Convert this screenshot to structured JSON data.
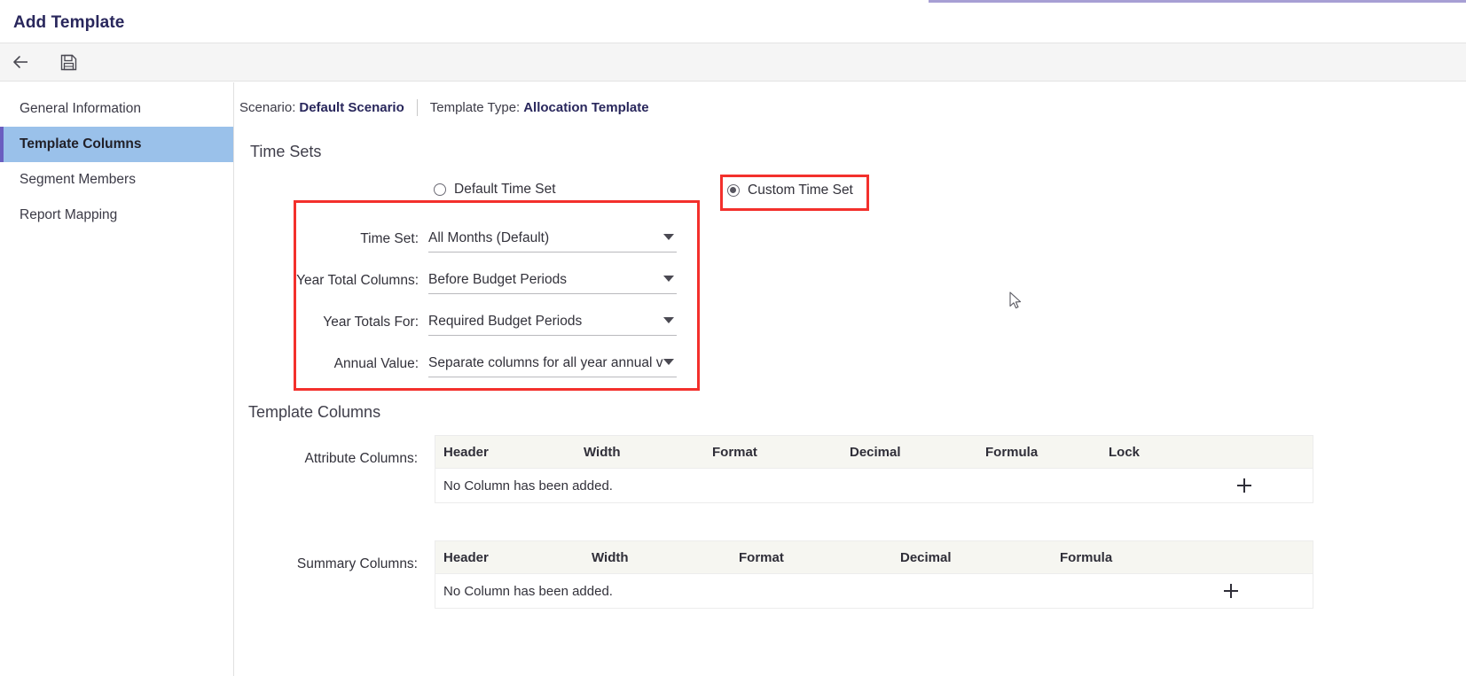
{
  "window": {
    "title": "Add Template",
    "accent_color": "#a79fd4"
  },
  "toolbar": {
    "back_label": "Back",
    "save_label": "Save",
    "icons": [
      "back-arrow-icon",
      "save-icon"
    ]
  },
  "sidebar": {
    "items": [
      {
        "label": "General Information",
        "active": false
      },
      {
        "label": "Template Columns",
        "active": true
      },
      {
        "label": "Segment Members",
        "active": false
      },
      {
        "label": "Report Mapping",
        "active": false
      }
    ],
    "active_color": "#9ac1ea",
    "active_bar_color": "#6a5ec0"
  },
  "breadcrumb": {
    "scenario_label": "Scenario:",
    "scenario_value": "Default Scenario",
    "template_type_label": "Template Type:",
    "template_type_value": "Allocation Template"
  },
  "time_sets": {
    "heading": "Time Sets",
    "radios": [
      {
        "label": "Default Time Set",
        "selected": false
      },
      {
        "label": "Custom Time Set",
        "selected": true
      }
    ],
    "fields": [
      {
        "label": "Time Set:",
        "value": "All Months (Default)"
      },
      {
        "label": "Year Total Columns:",
        "value": "Before Budget Periods"
      },
      {
        "label": "Year Totals For:",
        "value": "Required Budget Periods"
      },
      {
        "label": "Annual Value:",
        "value": "Separate columns for all year annual v"
      }
    ]
  },
  "template_columns": {
    "heading": "Template Columns",
    "attribute": {
      "label": "Attribute Columns:",
      "headers": [
        "Header",
        "Width",
        "Format",
        "Decimal",
        "Formula",
        "Lock"
      ],
      "empty_message": "No Column has been added.",
      "add_label": "+"
    },
    "summary": {
      "label": "Summary Columns:",
      "headers": [
        "Header",
        "Width",
        "Format",
        "Decimal",
        "Formula"
      ],
      "empty_message": "No Column has been added.",
      "add_label": "+"
    }
  },
  "annotations": {
    "highlight_color": "#f3302c",
    "boxes": [
      "custom-time-set-radio",
      "time-set-fields-group"
    ]
  }
}
